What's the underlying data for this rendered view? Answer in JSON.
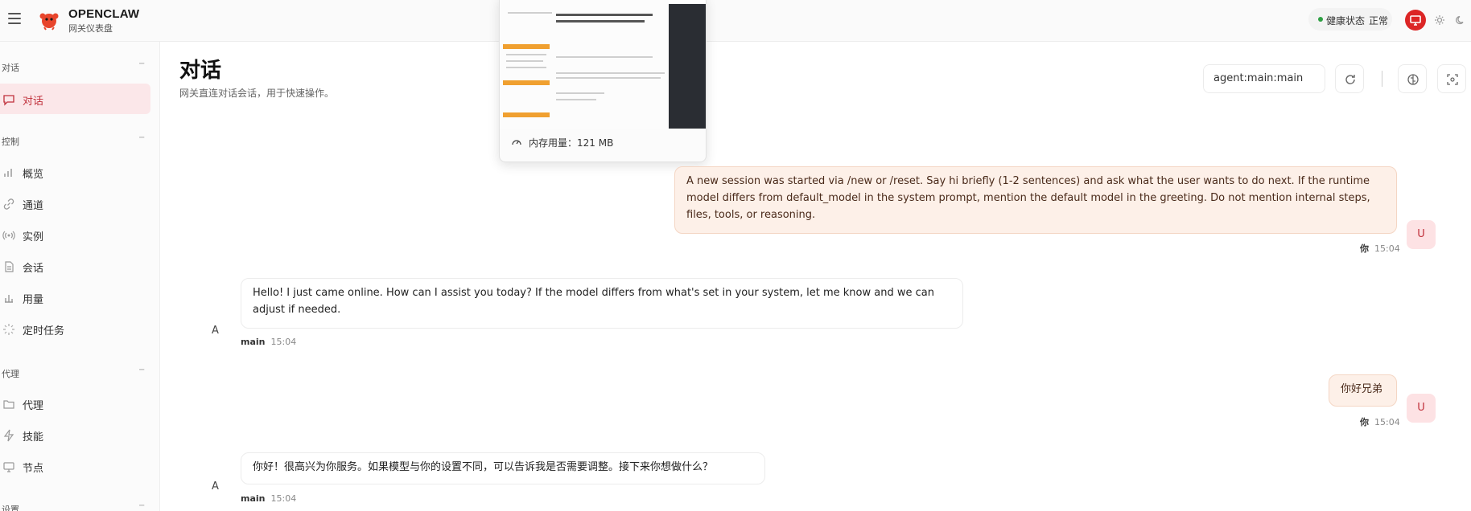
{
  "app": {
    "brand": "OPENCLAW",
    "subtitle": "网关仪表盘"
  },
  "topbar": {
    "health_label": "健康状态",
    "health_value": "正常",
    "icons": [
      "monitor-icon",
      "sun-icon",
      "moon-icon"
    ]
  },
  "sidebar": {
    "sections": [
      {
        "title": "对话",
        "items": [
          {
            "label": "对话",
            "icon": "chat-icon",
            "active": true
          }
        ]
      },
      {
        "title": "控制",
        "items": [
          {
            "label": "概览",
            "icon": "bar-chart-icon"
          },
          {
            "label": "通道",
            "icon": "link-icon"
          },
          {
            "label": "实例",
            "icon": "broadcast-icon"
          },
          {
            "label": "会话",
            "icon": "file-icon"
          },
          {
            "label": "用量",
            "icon": "bar-chart-icon"
          },
          {
            "label": "定时任务",
            "icon": "loader-icon"
          }
        ]
      },
      {
        "title": "代理",
        "items": [
          {
            "label": "代理",
            "icon": "folder-icon"
          },
          {
            "label": "技能",
            "icon": "zap-icon"
          },
          {
            "label": "节点",
            "icon": "monitor-icon"
          }
        ]
      },
      {
        "title": "设置",
        "items": []
      }
    ]
  },
  "page": {
    "title": "对话",
    "subtitle": "网关直连对话会话，用于快速操作。"
  },
  "controls": {
    "session_key": "agent:main:main",
    "icons": [
      "refresh-icon",
      "brain-icon",
      "focus-icon"
    ]
  },
  "popup": {
    "memory_label": "内存用量：121 MB"
  },
  "messages": [
    {
      "role": "user",
      "avatar": "U",
      "text": "A new session was started via /new or /reset. Say hi briefly (1-2 sentences) and ask what the user wants to do next. If the runtime model differs from default_model in the system prompt, mention the default model in the greeting. Do not mention internal steps, files, tools, or reasoning.",
      "sender": "你",
      "time": "15:04"
    },
    {
      "role": "assistant",
      "avatar": "A",
      "text": "Hello! I just came online. How can I assist you today? If the model differs from what's set in your system, let me know and we can adjust if needed.",
      "sender": "main",
      "time": "15:04"
    },
    {
      "role": "user",
      "avatar": "U",
      "text": "你好兄弟",
      "sender": "你",
      "time": "15:04"
    },
    {
      "role": "assistant",
      "avatar": "A",
      "text": "你好！很高兴为你服务。如果模型与你的设置不同，可以告诉我是否需要调整。接下来你想做什么？",
      "sender": "main",
      "time": "15:04"
    }
  ]
}
